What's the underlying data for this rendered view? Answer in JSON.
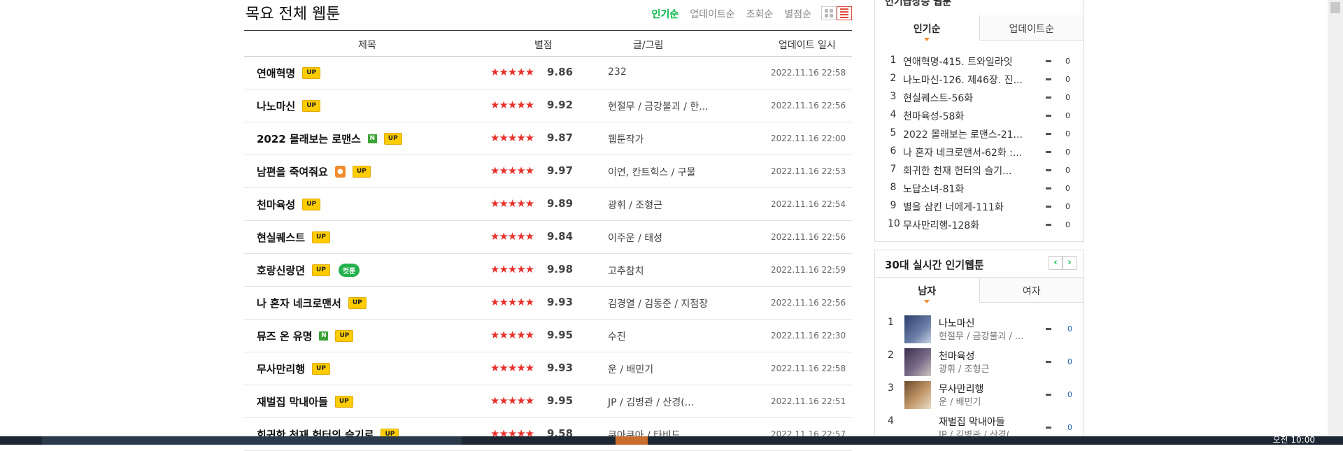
{
  "page": {
    "title": "목요 전체 웹툰",
    "sort_options": [
      {
        "label": "인기순",
        "active": true
      },
      {
        "label": "업데이트순",
        "active": false
      },
      {
        "label": "조회순",
        "active": false
      },
      {
        "label": "별점순",
        "active": false
      }
    ]
  },
  "table": {
    "headers": {
      "title": "제목",
      "rating": "별점",
      "author": "글/그림",
      "date": "업데이트 일시"
    },
    "stars": "★★★★★",
    "rows": [
      {
        "title": "연애혁명",
        "badges": [
          "UP"
        ],
        "rating": "9.86",
        "author": "232",
        "date": "2022.11.16 22:58"
      },
      {
        "title": "나노마신",
        "badges": [
          "UP"
        ],
        "rating": "9.92",
        "author": "현절무 / 금강불괴 / 한...",
        "date": "2022.11.16 22:56"
      },
      {
        "title": "2022 몰래보는 로맨스",
        "badges": [
          "N",
          "UP"
        ],
        "rating": "9.87",
        "author": "웹툰작가",
        "date": "2022.11.16 22:00"
      },
      {
        "title": "남편을 죽여줘요",
        "badges": [
          "LOCK",
          "UP"
        ],
        "rating": "9.97",
        "author": "이연, 칸트힉스 / 구물",
        "date": "2022.11.16 22:53"
      },
      {
        "title": "천마육성",
        "badges": [
          "UP"
        ],
        "rating": "9.89",
        "author": "광휘 / 조형근",
        "date": "2022.11.16 22:54"
      },
      {
        "title": "현실퀘스트",
        "badges": [
          "UP"
        ],
        "rating": "9.84",
        "author": "이주운 / 태성",
        "date": "2022.11.16 22:56"
      },
      {
        "title": "호랑신랑뎐",
        "badges": [
          "UP",
          "컷툰"
        ],
        "rating": "9.98",
        "author": "고추참치",
        "date": "2022.11.16 22:59"
      },
      {
        "title": "나 혼자 네크로맨서",
        "badges": [
          "UP"
        ],
        "rating": "9.93",
        "author": "김경열 / 김동준 / 지점장",
        "date": "2022.11.16 22:56"
      },
      {
        "title": "뮤즈 온 유명",
        "badges": [
          "N",
          "UP"
        ],
        "rating": "9.95",
        "author": "수진",
        "date": "2022.11.16 22:30"
      },
      {
        "title": "무사만리행",
        "badges": [
          "UP"
        ],
        "rating": "9.93",
        "author": "운 / 배민기",
        "date": "2022.11.16 22:58"
      },
      {
        "title": "재벌집 막내아들",
        "badges": [
          "UP"
        ],
        "rating": "9.95",
        "author": "JP / 김병관 / 산경(...",
        "date": "2022.11.16 22:51"
      },
      {
        "title": "회귀한 천재 헌터의 슬기로",
        "badges": [
          "UP"
        ],
        "rating": "9.58",
        "author": "쿠아쿠아 / 타비드",
        "date": "2022.11.16 22:57"
      }
    ]
  },
  "sidebar": {
    "panel1": {
      "title_cut": "인기급상승 웹툰",
      "tabs": [
        {
          "label": "인기순",
          "active": true
        },
        {
          "label": "업데이트순",
          "active": false
        }
      ],
      "items": [
        {
          "rank": "1",
          "title": "연애혁명-415. 트와일라잇",
          "change": "0"
        },
        {
          "rank": "2",
          "title": "나노마신-126. 제46장. 진...",
          "change": "0"
        },
        {
          "rank": "3",
          "title": "현실퀘스트-56화",
          "change": "0"
        },
        {
          "rank": "4",
          "title": "천마육성-58화",
          "change": "0"
        },
        {
          "rank": "5",
          "title": "2022 몰래보는 로맨스-21...",
          "change": "0"
        },
        {
          "rank": "6",
          "title": "나 혼자 네크로맨서-62화 :...",
          "change": "0"
        },
        {
          "rank": "7",
          "title": "회귀한 천재 헌터의 슬기...",
          "change": "0"
        },
        {
          "rank": "8",
          "title": "노답소녀-81화",
          "change": "0"
        },
        {
          "rank": "9",
          "title": "별을 삼킨 너에게-111화",
          "change": "0"
        },
        {
          "rank": "10",
          "title": "무사만리행-128화",
          "change": "0"
        }
      ]
    },
    "panel2": {
      "title": "30대 실시간 인기웹툰",
      "prev": "‹",
      "next": "›",
      "tabs": [
        {
          "label": "남자",
          "active": true
        },
        {
          "label": "여자",
          "active": false
        }
      ],
      "items": [
        {
          "rank": "1",
          "title": "나노마신",
          "author": "현절무 / 금강불괴 / ...",
          "change": "0"
        },
        {
          "rank": "2",
          "title": "천마육성",
          "author": "광휘 / 조형근",
          "change": "0"
        },
        {
          "rank": "3",
          "title": "무사만리행",
          "author": "운 / 배민기",
          "change": "0"
        },
        {
          "rank": "4",
          "title": "재벌집 막내아들",
          "author": "JP / 김병관 / 산경(...",
          "change": "0"
        }
      ]
    }
  },
  "taskbar": {
    "clock": "오전 10:00"
  }
}
